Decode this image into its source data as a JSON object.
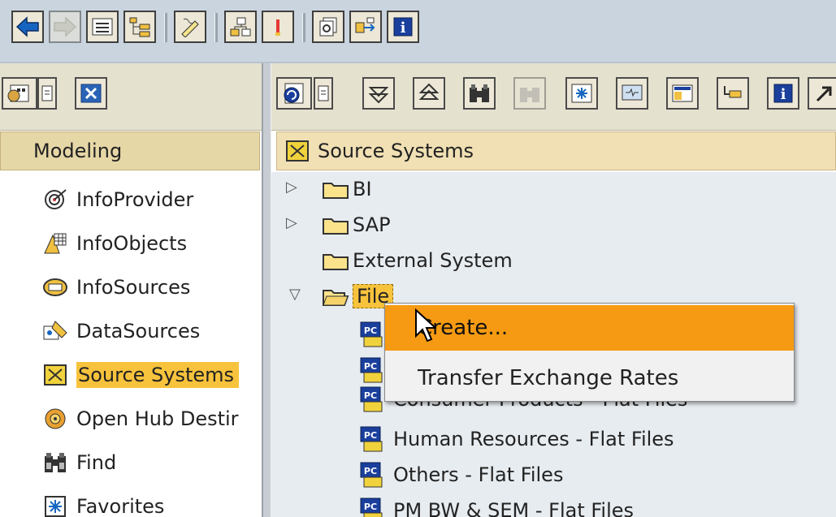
{
  "toolbar": {
    "icons": [
      "back-icon",
      "forward-icon",
      "list-icon",
      "tree-structure-icon",
      "edit-icon",
      "hierarchy-icon",
      "info-bulb-icon",
      "copy-pages-icon",
      "transfer-icon",
      "info-icon"
    ]
  },
  "left_panel": {
    "tools": [
      "settings-icon",
      "doc-icon",
      "close-icon"
    ],
    "header": "Modeling",
    "items": [
      {
        "label": "InfoProvider",
        "icon": "infoprovider-icon"
      },
      {
        "label": "InfoObjects",
        "icon": "infoobjects-icon"
      },
      {
        "label": "InfoSources",
        "icon": "infosources-icon"
      },
      {
        "label": "DataSources",
        "icon": "datasources-icon"
      },
      {
        "label": "Source Systems",
        "icon": "source-systems-icon",
        "selected": true
      },
      {
        "label": "Open Hub Destir",
        "icon": "open-hub-icon"
      },
      {
        "label": "Find",
        "icon": "binoculars-icon"
      },
      {
        "label": "Favorites",
        "icon": "favorites-icon"
      }
    ]
  },
  "right_panel": {
    "header": "Source Systems",
    "tree": [
      {
        "label": "BI",
        "expander": "▷"
      },
      {
        "label": "SAP",
        "expander": "▷"
      },
      {
        "label": "External System",
        "expander": ""
      },
      {
        "label": "File",
        "expander": "▽",
        "expanded": true
      }
    ],
    "leaves": [
      "Consumer Products - Flat Files",
      "Human Resources - Flat Files",
      "Others - Flat Files",
      "PM BW & SEM - Flat Files"
    ]
  },
  "context_menu": {
    "items": [
      "Create...",
      "Transfer Exchange Rates"
    ],
    "highlighted": 0
  },
  "colors": {
    "selection": "#f8c33c",
    "menu_highlight": "#f59a12",
    "tree_bg": "#e7ecf0",
    "header_bg": "#f0e0b3"
  }
}
